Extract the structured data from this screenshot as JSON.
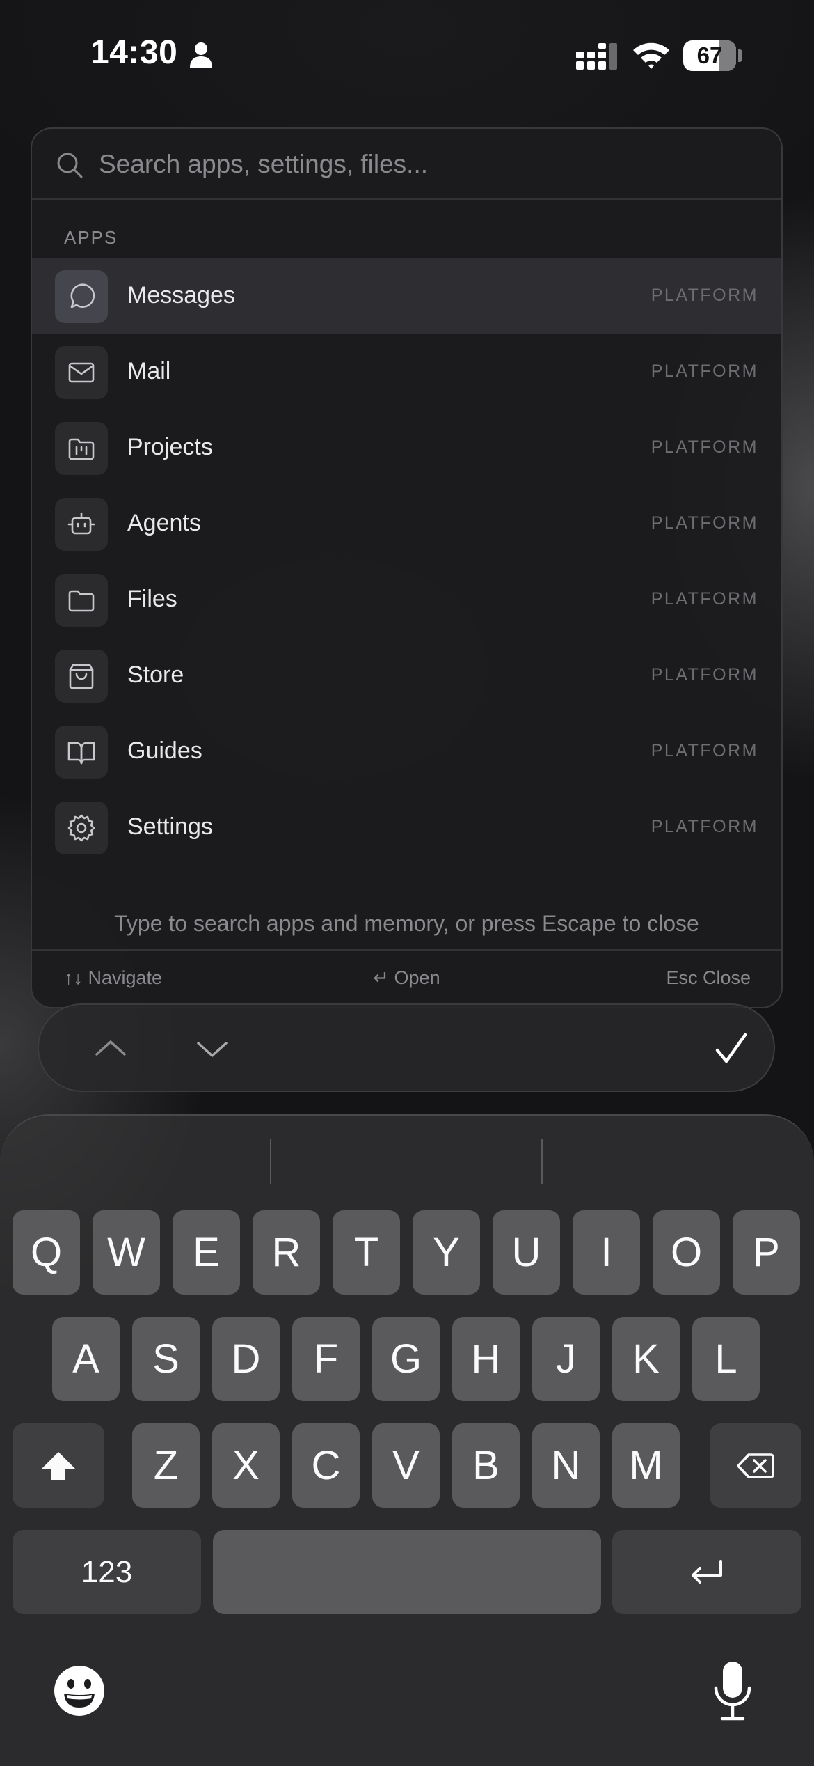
{
  "status_bar": {
    "time": "14:30",
    "battery": "67",
    "battery_level": 0.67
  },
  "search": {
    "placeholder": "Search apps, settings, files...",
    "value": ""
  },
  "section_label": "APPS",
  "items": [
    {
      "label": "Messages",
      "tag": "PLATFORM",
      "icon": "message-bubble-icon",
      "selected": true
    },
    {
      "label": "Mail",
      "tag": "PLATFORM",
      "icon": "mail-icon",
      "selected": false
    },
    {
      "label": "Projects",
      "tag": "PLATFORM",
      "icon": "folder-kanban-icon",
      "selected": false
    },
    {
      "label": "Agents",
      "tag": "PLATFORM",
      "icon": "robot-icon",
      "selected": false
    },
    {
      "label": "Files",
      "tag": "PLATFORM",
      "icon": "folder-icon",
      "selected": false
    },
    {
      "label": "Store",
      "tag": "PLATFORM",
      "icon": "shopping-bag-icon",
      "selected": false
    },
    {
      "label": "Guides",
      "tag": "PLATFORM",
      "icon": "book-open-icon",
      "selected": false
    },
    {
      "label": "Settings",
      "tag": "PLATFORM",
      "icon": "gear-icon",
      "selected": false
    }
  ],
  "hint": "Type to search apps and memory, or press Escape to close",
  "footer": {
    "navigate": "↑↓ Navigate",
    "open": "↵ Open",
    "close": "Esc Close"
  },
  "accessory": {
    "prev_icon": "chevron-up-icon",
    "next_icon": "chevron-down-icon",
    "done_icon": "checkmark-icon"
  },
  "keyboard": {
    "row1": [
      "Q",
      "W",
      "E",
      "R",
      "T",
      "Y",
      "U",
      "I",
      "O",
      "P"
    ],
    "row2": [
      "A",
      "S",
      "D",
      "F",
      "G",
      "H",
      "J",
      "K",
      "L"
    ],
    "row3": [
      "Z",
      "X",
      "C",
      "V",
      "B",
      "N",
      "M"
    ],
    "numbers_label": "123",
    "shift_icon": "shift-icon",
    "delete_icon": "backspace-icon",
    "return_icon": "return-icon",
    "emoji_icon": "emoji-icon",
    "mic_icon": "microphone-icon"
  }
}
